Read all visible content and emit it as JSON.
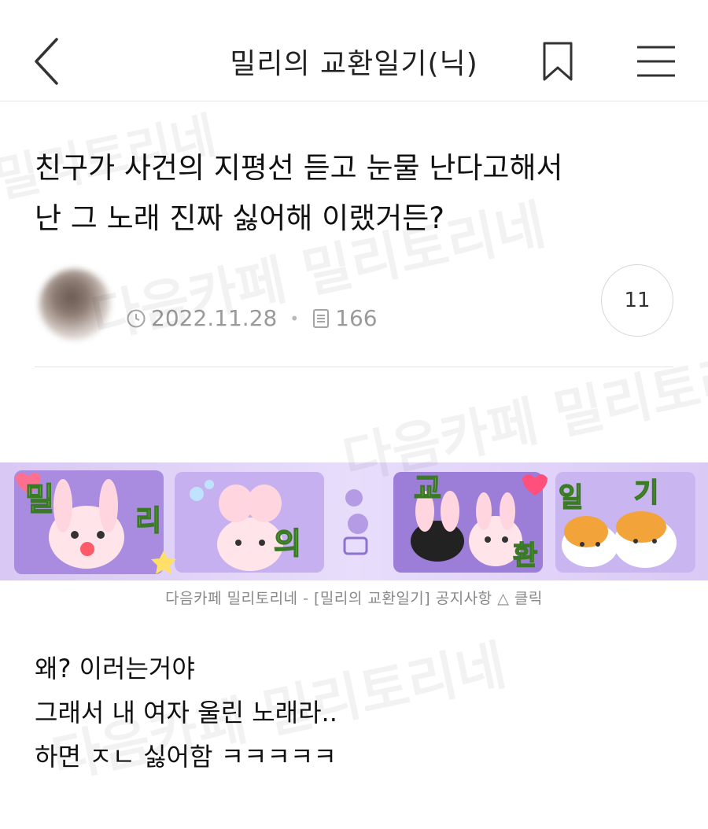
{
  "header": {
    "title": "밀리의 교환일기(닉)"
  },
  "post": {
    "title_line1": "친구가 사건의 지평선 듣고 눈물 난다고해서",
    "title_line2": "난 그 노래 진짜 싫어해 이랬거든?",
    "date": "2022.11.28",
    "views": "166",
    "comments": "11"
  },
  "banner": {
    "letters": [
      "밀",
      "리",
      "의",
      "교",
      "환",
      "일",
      "기"
    ],
    "caption": "다음카페 밀리토리네 - [밀리의 교환일기] 공지사항 △ 클릭"
  },
  "body": {
    "lines": [
      "왜? 이러는거야",
      "그래서 내 여자 울린 노래라..",
      "하면 ㅈㄴ 싫어함 ㅋㅋㅋㅋㅋ"
    ]
  },
  "watermark": {
    "text_a": "밀리토리네",
    "text_b": "다음카페 밀리토리네"
  },
  "colors": {
    "banner_purple": "#9b7fd9",
    "letter_green": "#7ed957",
    "letter_pink": "#f06fa6",
    "icon_gray": "#9a9a9a"
  },
  "icons": {
    "back": "chevron-left-icon",
    "bookmark": "bookmark-icon",
    "menu": "hamburger-menu-icon",
    "clock": "clock-icon",
    "views": "document-icon"
  }
}
